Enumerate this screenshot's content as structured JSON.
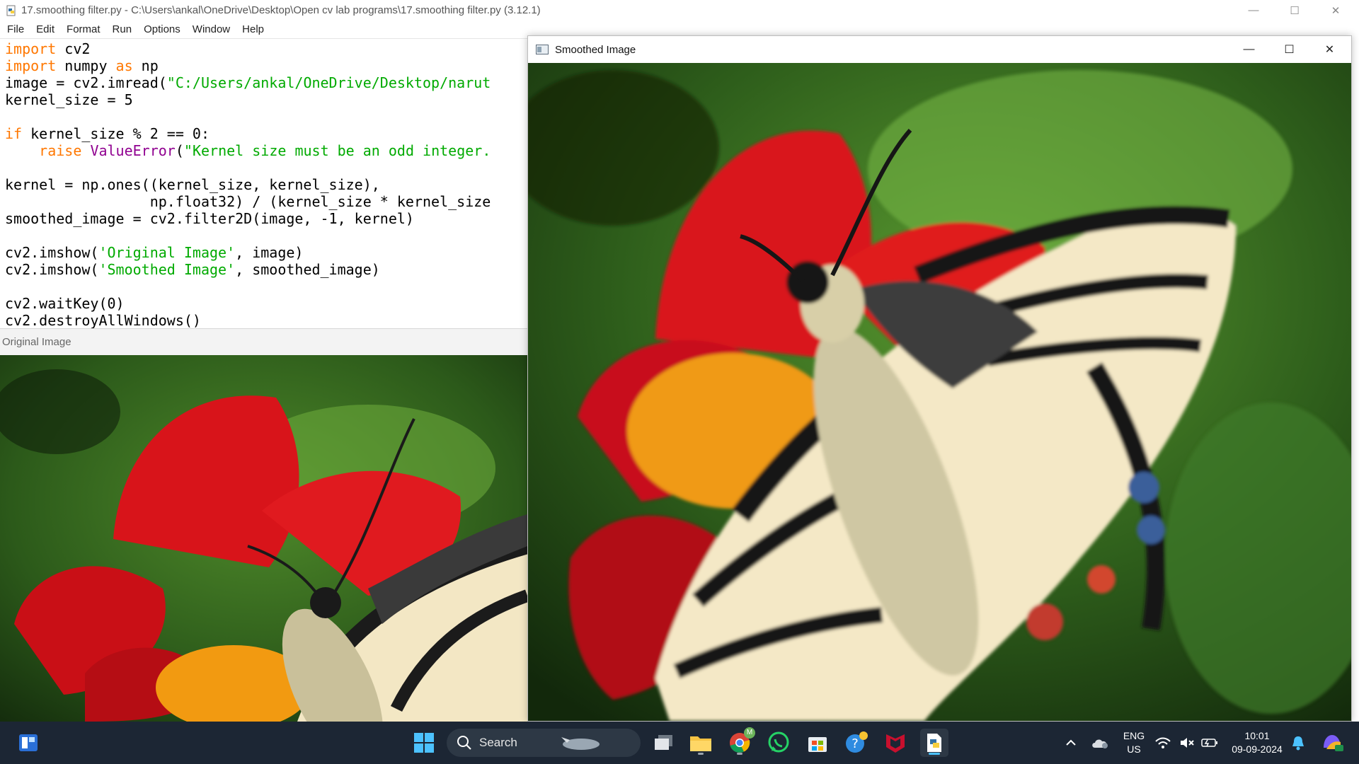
{
  "idle": {
    "window_title": "17.smoothing filter.py - C:\\Users\\ankal\\OneDrive\\Desktop\\Open cv lab programs\\17.smoothing filter.py (3.12.1)",
    "menu": [
      "File",
      "Edit",
      "Format",
      "Run",
      "Options",
      "Window",
      "Help"
    ],
    "code_lines": [
      "import cv2",
      "import numpy as np",
      "image = cv2.imread(\"C:/Users/ankal/OneDrive/Desktop/narut",
      "kernel_size = 5",
      "",
      "if kernel_size % 2 == 0:",
      "    raise ValueError(\"Kernel size must be an odd integer.",
      "",
      "kernel = np.ones((kernel_size, kernel_size),",
      "                 np.float32) / (kernel_size * kernel_size",
      "smoothed_image = cv2.filter2D(image, -1, kernel)",
      "",
      "cv2.imshow('Original Image', image)",
      "cv2.imshow('Smoothed Image', smoothed_image)",
      "",
      "cv2.waitKey(0)",
      "cv2.destroyAllWindows()"
    ]
  },
  "original_window": {
    "title": "Original Image"
  },
  "smoothed_window": {
    "title": "Smoothed Image"
  },
  "window_controls": {
    "minimize": "—",
    "maximize": "☐",
    "close": "✕"
  },
  "taskbar": {
    "search_label": "Search",
    "language": "ENG",
    "region": "US",
    "time": "10:01",
    "date": "09-09-2024",
    "chrome_badge": "M",
    "icons": [
      "windows-start-icon",
      "search-icon",
      "task-view-icon",
      "file-explorer-icon",
      "chrome-icon",
      "whatsapp-icon",
      "microsoft-store-icon",
      "get-help-icon",
      "mcafee-icon",
      "python-idle-icon",
      "chevron-up-icon",
      "onedrive-icon",
      "wifi-icon",
      "volume-muted-icon",
      "battery-icon",
      "notification-bell-icon",
      "copilot-icon"
    ]
  },
  "colors": {
    "taskbar_bg": "#1c2634",
    "keyword": "#ff7700",
    "string": "#00aa00",
    "builtin": "#900090"
  }
}
